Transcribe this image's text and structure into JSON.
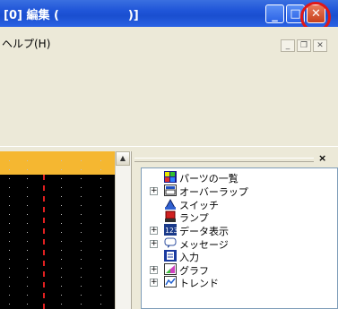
{
  "window": {
    "title": "[0] 編集 (                 )]",
    "buttons": [
      "minimize-icon",
      "maximize-icon",
      "close-icon"
    ],
    "accent": "#1f55d8",
    "highlight_color": "#e01818"
  },
  "menu": {
    "help": "ヘルプ(H)"
  },
  "panel": {
    "close_label": "×"
  },
  "tree": {
    "items": [
      {
        "label": "パーツの一覧",
        "expandable": false,
        "icon": "parts-list-icon"
      },
      {
        "label": "オーバーラップ",
        "expandable": true,
        "icon": "overlap-icon"
      },
      {
        "label": "スイッチ",
        "expandable": false,
        "icon": "switch-icon"
      },
      {
        "label": "ランプ",
        "expandable": false,
        "icon": "lamp-icon"
      },
      {
        "label": "データ表示",
        "expandable": true,
        "icon": "data-display-icon"
      },
      {
        "label": "メッセージ",
        "expandable": true,
        "icon": "message-icon"
      },
      {
        "label": "入力",
        "expandable": false,
        "icon": "input-icon"
      },
      {
        "label": "グラフ",
        "expandable": true,
        "icon": "graph-icon"
      },
      {
        "label": "トレンド",
        "expandable": true,
        "icon": "trend-icon"
      }
    ]
  }
}
